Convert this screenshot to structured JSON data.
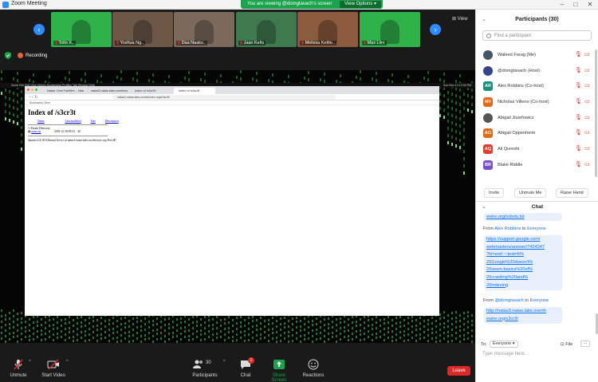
{
  "window": {
    "title": "Zoom Meeting",
    "min": "–",
    "max": "□",
    "close": "✕"
  },
  "share_banner": {
    "text": "You are viewing @domgtavach's screen",
    "view_options": "View Options ▾"
  },
  "gallery": {
    "view_label": "View",
    "thumbs": [
      {
        "name": "Tollo X..",
        "bg": "#2fb24a"
      },
      {
        "name": "Yoshua Ng..",
        "bg": "#6d5848"
      },
      {
        "name": "Daa Naaks..",
        "bg": "#7b6a5c"
      },
      {
        "name": "Jaan Kelts",
        "bg": "#3f7a4f"
      },
      {
        "name": "Melissa Kettle..",
        "bg": "#8c5a3d"
      },
      {
        "name": "Max Lilm",
        "bg": "#2fb24a"
      }
    ]
  },
  "recording": {
    "label": "Recording"
  },
  "shared": {
    "mac_menu": "Zoom  File  Edit  View  History  Bookmarks  Profiles  Tab  Window  Help",
    "mac_clock": "Sun Nov 13  12:34 PM",
    "tabs": [
      "Natas: OverTheWire – Natas 3",
      "natas3.natas.labs.overthewire.org",
      "Index of /s3cr3t",
      "Index of /s3cr3t"
    ],
    "url": "natas3.natas.labs.overthewire.org/s3cr3t/",
    "bookmarks": "Bookmarks    Other",
    "page": {
      "heading": "Index of /s3cr3t",
      "columns": [
        "Name",
        "Last modified",
        "Size",
        "Description"
      ],
      "parent": "Parent Directory",
      "file": "users.txt",
      "file_date": "2019-12-18 09:53",
      "file_size": "40",
      "address": "Apache/2.4.18 (Ubuntu) Server at natas3.natas.labs.overthewire.org Port 80"
    }
  },
  "toolbar": {
    "unmute": "Unmute",
    "start_video": "Start Video",
    "participants": "Participants",
    "participants_count": "30",
    "chat": "Chat",
    "chat_badge": "2",
    "share_screen": "Share Screen",
    "reactions": "Reactions",
    "leave": "Leave"
  },
  "participants_panel": {
    "title": "Participants (30)",
    "search_placeholder": "Find a participant",
    "people": [
      {
        "name": "Waleed Farag (Me)",
        "initials": "",
        "color": "#445566"
      },
      {
        "name": "@domgtavach (Host)",
        "initials": "",
        "color": "#334488"
      },
      {
        "name": "Alex Robbins (Co-host)",
        "initials": "AR",
        "color": "#1a8f7a"
      },
      {
        "name": "Nicholas Villeno (Co-host)",
        "initials": "NV",
        "color": "#e06a1a"
      },
      {
        "name": "Abigail Jozefowicz",
        "initials": "",
        "color": "#555555"
      },
      {
        "name": "Abigail Oppenheim",
        "initials": "AO",
        "color": "#e06a1a"
      },
      {
        "name": "Ali Qureshi",
        "initials": "AQ",
        "color": "#e03b2b"
      },
      {
        "name": "Blake Riddle",
        "initials": "BR",
        "color": "#7a4fcf"
      }
    ],
    "invite": "Invite",
    "unmute_me": "Unmute Me",
    "raise_hand": "Raise Hand"
  },
  "chat": {
    "title": "Chat",
    "prev_link_tail": "ewire.org/robots.txt",
    "msg1_from": "From",
    "msg1_sender": "Alex Robbins",
    "msg1_to": "to",
    "msg1_recipient": "Everyone",
    "msg1_lines": [
      "https://support.google.com/",
      "webmasters/answer/7424347",
      "?hl=en#:~:text=It%",
      "20Google%20doesn't%",
      "20seem.basics%20of%",
      "20crawling%20and%",
      "20indexing"
    ],
    "msg2_from": "From",
    "msg2_sender": "@domgtavach",
    "msg2_to": "to",
    "msg2_recipient": "Everyone",
    "msg2_lines": [
      "http://natas3.natas.labs.overth",
      "ewire.org/s3cr3t"
    ],
    "to_label": "To:",
    "to_value": "Everyone ▾",
    "file_label": "File",
    "more_label": "···",
    "input_placeholder": "Type message here..."
  }
}
